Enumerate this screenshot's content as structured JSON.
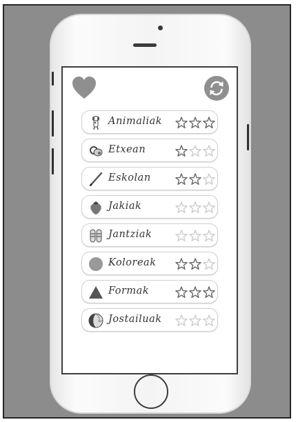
{
  "header": {
    "favorites_icon": "heart-icon",
    "refresh_icon": "refresh-icon"
  },
  "categories": [
    {
      "label": "Animaliak",
      "icon": "dog-icon",
      "stars": 3
    },
    {
      "label": "Etxean",
      "icon": "pacifier-icon",
      "stars": 1
    },
    {
      "label": "Eskolan",
      "icon": "pencil-icon",
      "stars": 2
    },
    {
      "label": "Jakiak",
      "icon": "strawberry-icon",
      "stars": 0
    },
    {
      "label": "Jantziak",
      "icon": "sandals-icon",
      "stars": 0
    },
    {
      "label": "Koloreak",
      "icon": "circle-icon",
      "stars": 2
    },
    {
      "label": "Formak",
      "icon": "triangle-icon",
      "stars": 3
    },
    {
      "label": "Jostailuak",
      "icon": "ball-icon",
      "stars": 0
    }
  ],
  "colors": {
    "background": "#8c8c8c",
    "heart": "#8f8f8f",
    "star_filled_outline": "#666666",
    "star_empty_outline": "#cccccc"
  }
}
